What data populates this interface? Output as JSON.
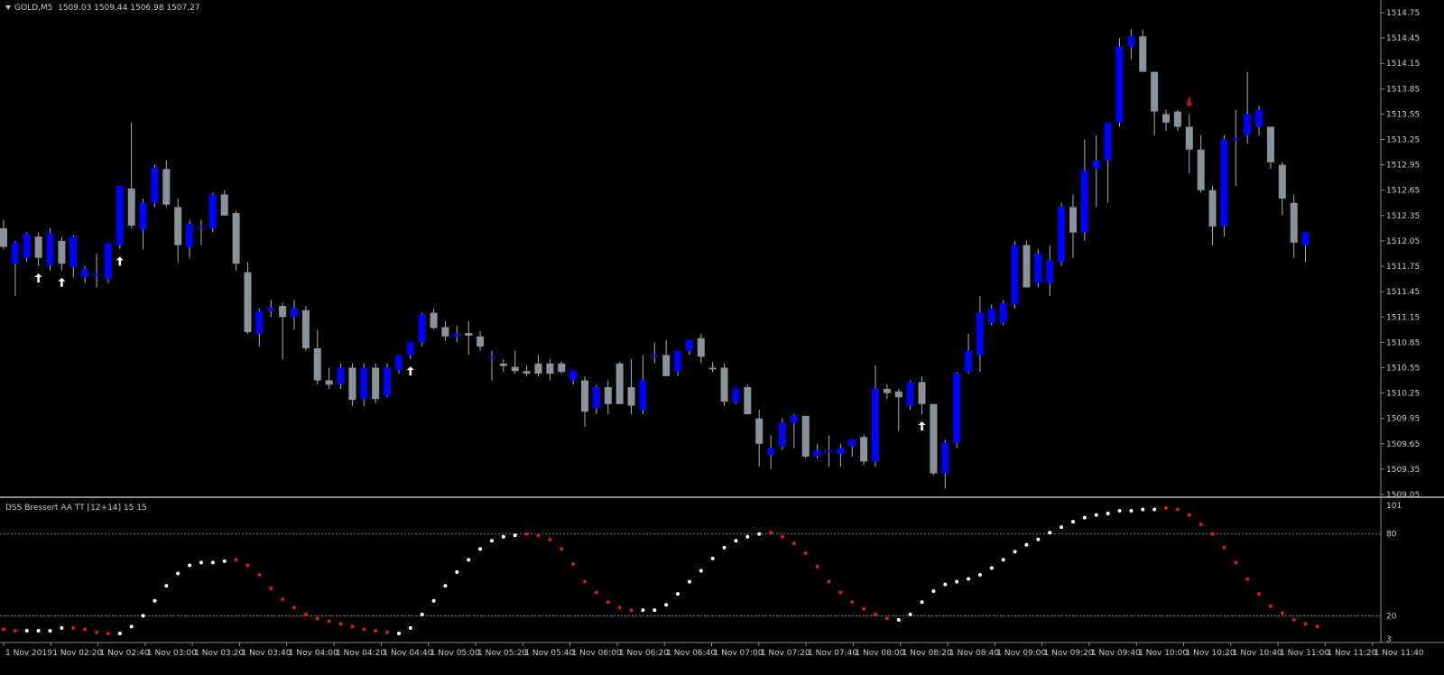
{
  "header": {
    "symbol": "GOLD,M5",
    "ohlc": "1509.03 1509.44 1506.98 1507.27"
  },
  "indicator": {
    "title": "DSS Bressert AA TT [12+14] 15 15"
  },
  "colors": {
    "background": "#000000",
    "bull_candle": "#0000ff",
    "bear_candle": "#8a939c",
    "wick": "#aab0b8",
    "axis": "#8a8a8a",
    "label": "#c8c8c8",
    "up_arrow": "#ffffff",
    "down_arrow": "#e01010",
    "dot_up": "#ffffff",
    "dot_down": "#e01818",
    "level_line": "#6a7a90"
  },
  "icons": {
    "up_arrow": "up-arrow-icon",
    "down_arrow": "down-arrow-icon",
    "header_triangle": "dropdown-triangle-icon"
  },
  "chart_data": {
    "type": "candlestick",
    "price_axis": {
      "min": 1509.05,
      "max": 1514.75,
      "ticks": [
        "1514.75",
        "1514.45",
        "1514.15",
        "1513.85",
        "1513.55",
        "1513.25",
        "1512.95",
        "1512.65",
        "1512.35",
        "1512.05",
        "1511.75",
        "1511.45",
        "1511.15",
        "1510.85",
        "1510.55",
        "1510.25",
        "1509.95",
        "1509.65",
        "1509.35",
        "1509.05"
      ]
    },
    "time_axis": {
      "labels": [
        "1 Nov 2019",
        "1 Nov 02:20",
        "1 Nov 02:40",
        "1 Nov 03:00",
        "1 Nov 03:20",
        "1 Nov 03:40",
        "1 Nov 04:00",
        "1 Nov 04:20",
        "1 Nov 04:40",
        "1 Nov 05:00",
        "1 Nov 05:20",
        "1 Nov 05:40",
        "1 Nov 06:00",
        "1 Nov 06:20",
        "1 Nov 06:40",
        "1 Nov 07:00",
        "1 Nov 07:20",
        "1 Nov 07:40",
        "1 Nov 08:00",
        "1 Nov 08:20",
        "1 Nov 08:40",
        "1 Nov 09:00",
        "1 Nov 09:20",
        "1 Nov 09:40",
        "1 Nov 10:00",
        "1 Nov 10:20",
        "1 Nov 10:40",
        "1 Nov 11:00",
        "1 Nov 11:20",
        "1 Nov 11:40"
      ]
    },
    "candles": [
      [
        1512.2,
        1512.3,
        1511.95,
        1511.98
      ],
      [
        1511.78,
        1512.05,
        1511.4,
        1512.03
      ],
      [
        1511.85,
        1512.15,
        1511.8,
        1512.13
      ],
      [
        1512.1,
        1512.15,
        1511.75,
        1511.85
      ],
      [
        1511.76,
        1512.2,
        1511.7,
        1512.14
      ],
      [
        1512.05,
        1512.1,
        1511.7,
        1511.78
      ],
      [
        1511.74,
        1512.12,
        1511.62,
        1512.1
      ],
      [
        1511.62,
        1511.75,
        1511.55,
        1511.72
      ],
      [
        1511.64,
        1511.9,
        1511.5,
        1511.66
      ],
      [
        1511.6,
        1512.0,
        1511.55,
        1512.02
      ],
      [
        1512.0,
        1512.7,
        1511.95,
        1512.7
      ],
      [
        1512.67,
        1513.45,
        1512.2,
        1512.23
      ],
      [
        1512.18,
        1512.55,
        1511.95,
        1512.5
      ],
      [
        1512.5,
        1512.95,
        1512.45,
        1512.92
      ],
      [
        1512.9,
        1513.0,
        1512.45,
        1512.48
      ],
      [
        1512.45,
        1512.55,
        1511.8,
        1512.0
      ],
      [
        1511.98,
        1512.3,
        1511.85,
        1512.25
      ],
      [
        1512.22,
        1512.3,
        1512.0,
        1512.22
      ],
      [
        1512.2,
        1512.62,
        1512.15,
        1512.6
      ],
      [
        1512.6,
        1512.65,
        1512.35,
        1512.35
      ],
      [
        1512.38,
        1512.4,
        1511.7,
        1511.78
      ],
      [
        1511.68,
        1511.8,
        1510.95,
        1510.97
      ],
      [
        1510.95,
        1511.25,
        1510.8,
        1511.22
      ],
      [
        1511.22,
        1511.35,
        1511.15,
        1511.26
      ],
      [
        1511.28,
        1511.32,
        1510.65,
        1511.15
      ],
      [
        1511.15,
        1511.35,
        1511.0,
        1511.25
      ],
      [
        1511.23,
        1511.28,
        1510.75,
        1510.78
      ],
      [
        1510.78,
        1511.0,
        1510.35,
        1510.4
      ],
      [
        1510.4,
        1510.55,
        1510.3,
        1510.35
      ],
      [
        1510.36,
        1510.6,
        1510.3,
        1510.55
      ],
      [
        1510.55,
        1510.6,
        1510.1,
        1510.17
      ],
      [
        1510.18,
        1510.6,
        1510.1,
        1510.55
      ],
      [
        1510.55,
        1510.6,
        1510.13,
        1510.18
      ],
      [
        1510.22,
        1510.6,
        1510.2,
        1510.55
      ],
      [
        1510.52,
        1510.7,
        1510.48,
        1510.7
      ],
      [
        1510.7,
        1510.85,
        1510.65,
        1510.85
      ],
      [
        1510.85,
        1511.2,
        1510.8,
        1511.18
      ],
      [
        1511.2,
        1511.25,
        1511.0,
        1511.02
      ],
      [
        1511.03,
        1511.1,
        1510.87,
        1510.92
      ],
      [
        1510.92,
        1511.05,
        1510.85,
        1510.95
      ],
      [
        1510.96,
        1511.1,
        1510.7,
        1510.93
      ],
      [
        1510.92,
        1510.98,
        1510.75,
        1510.8
      ],
      [
        1510.68,
        1510.75,
        1510.4,
        1510.68
      ],
      [
        1510.6,
        1510.65,
        1510.5,
        1510.57
      ],
      [
        1510.56,
        1510.75,
        1510.48,
        1510.51
      ],
      [
        1510.51,
        1510.58,
        1510.45,
        1510.48
      ],
      [
        1510.6,
        1510.7,
        1510.45,
        1510.48
      ],
      [
        1510.6,
        1510.65,
        1510.4,
        1510.48
      ],
      [
        1510.6,
        1510.62,
        1510.48,
        1510.5
      ],
      [
        1510.4,
        1510.52,
        1510.35,
        1510.52
      ],
      [
        1510.4,
        1510.45,
        1509.85,
        1510.03
      ],
      [
        1510.07,
        1510.35,
        1510.0,
        1510.32
      ],
      [
        1510.32,
        1510.4,
        1510.0,
        1510.12
      ],
      [
        1510.6,
        1510.62,
        1510.12,
        1510.12
      ],
      [
        1510.32,
        1510.65,
        1510.0,
        1510.1
      ],
      [
        1510.05,
        1510.7,
        1510.0,
        1510.4
      ],
      [
        1510.68,
        1510.85,
        1510.6,
        1510.7
      ],
      [
        1510.7,
        1510.88,
        1510.5,
        1510.45
      ],
      [
        1510.5,
        1510.72,
        1510.45,
        1510.75
      ],
      [
        1510.75,
        1510.88,
        1510.7,
        1510.88
      ],
      [
        1510.9,
        1510.95,
        1510.6,
        1510.68
      ],
      [
        1510.55,
        1510.62,
        1510.5,
        1510.53
      ],
      [
        1510.55,
        1510.6,
        1510.1,
        1510.15
      ],
      [
        1510.14,
        1510.3,
        1510.12,
        1510.3
      ],
      [
        1510.32,
        1510.35,
        1510.0,
        1510.0
      ],
      [
        1509.95,
        1510.05,
        1509.38,
        1509.65
      ],
      [
        1509.52,
        1509.75,
        1509.35,
        1509.6
      ],
      [
        1509.62,
        1509.95,
        1509.58,
        1509.9
      ],
      [
        1509.9,
        1510.0,
        1509.6,
        1509.98
      ],
      [
        1509.98,
        1509.98,
        1509.48,
        1509.5
      ],
      [
        1509.5,
        1509.65,
        1509.48,
        1509.57
      ],
      [
        1509.55,
        1509.75,
        1509.38,
        1509.57
      ],
      [
        1509.53,
        1509.65,
        1509.38,
        1509.6
      ],
      [
        1509.62,
        1509.7,
        1509.5,
        1509.7
      ],
      [
        1509.73,
        1509.76,
        1509.4,
        1509.44
      ],
      [
        1509.44,
        1510.58,
        1509.38,
        1510.3
      ],
      [
        1510.3,
        1510.35,
        1510.18,
        1510.25
      ],
      [
        1510.27,
        1510.3,
        1509.8,
        1510.2
      ],
      [
        1510.1,
        1510.4,
        1510.05,
        1510.38
      ],
      [
        1510.38,
        1510.45,
        1510.0,
        1510.12
      ],
      [
        1510.12,
        1510.12,
        1509.28,
        1509.3
      ],
      [
        1509.3,
        1509.7,
        1509.12,
        1509.66
      ],
      [
        1509.66,
        1510.5,
        1509.6,
        1510.48
      ],
      [
        1510.5,
        1510.95,
        1510.48,
        1510.75
      ],
      [
        1510.7,
        1511.4,
        1510.5,
        1511.2
      ],
      [
        1511.08,
        1511.3,
        1511.05,
        1511.25
      ],
      [
        1511.08,
        1511.35,
        1511.05,
        1511.31
      ],
      [
        1511.3,
        1512.05,
        1511.25,
        1512.0
      ],
      [
        1512.0,
        1512.05,
        1511.5,
        1511.5
      ],
      [
        1511.55,
        1511.95,
        1511.5,
        1511.9
      ],
      [
        1511.55,
        1512.0,
        1511.4,
        1511.82
      ],
      [
        1511.8,
        1512.5,
        1511.75,
        1512.45
      ],
      [
        1512.45,
        1512.6,
        1511.85,
        1512.15
      ],
      [
        1512.15,
        1513.25,
        1512.05,
        1512.88
      ],
      [
        1512.9,
        1513.3,
        1512.45,
        1513.0
      ],
      [
        1513.0,
        1513.45,
        1512.5,
        1513.45
      ],
      [
        1513.45,
        1514.45,
        1513.4,
        1514.35
      ],
      [
        1514.35,
        1514.55,
        1514.2,
        1514.47
      ],
      [
        1514.47,
        1514.55,
        1514.05,
        1514.05
      ],
      [
        1514.05,
        1514.05,
        1513.3,
        1513.58
      ],
      [
        1513.55,
        1513.6,
        1513.35,
        1513.45
      ],
      [
        1513.58,
        1513.6,
        1513.35,
        1513.4
      ],
      [
        1513.4,
        1513.55,
        1512.85,
        1513.13
      ],
      [
        1513.13,
        1513.3,
        1512.62,
        1512.65
      ],
      [
        1512.65,
        1512.7,
        1512.0,
        1512.22
      ],
      [
        1512.22,
        1513.3,
        1512.1,
        1513.25
      ],
      [
        1513.25,
        1513.6,
        1512.7,
        1513.27
      ],
      [
        1513.3,
        1514.05,
        1513.2,
        1513.55
      ],
      [
        1513.4,
        1513.65,
        1513.3,
        1513.6
      ],
      [
        1513.4,
        1513.4,
        1512.9,
        1512.98
      ],
      [
        1512.95,
        1512.98,
        1512.35,
        1512.55
      ],
      [
        1512.5,
        1512.6,
        1511.85,
        1512.03
      ],
      [
        1512.0,
        1512.15,
        1511.8,
        1512.15
      ]
    ],
    "up_signals": [
      3,
      5,
      10,
      35,
      79
    ],
    "down_signals": [
      102
    ],
    "indicator": {
      "name": "DSS Bressert AA TT [12+14] 15 15",
      "axis": {
        "min": 3,
        "max": 101,
        "ticks": [
          "101",
          "80",
          "20",
          "3"
        ]
      },
      "levels": [
        80,
        20
      ],
      "values": [
        10,
        9,
        9,
        9,
        9,
        11,
        11,
        10,
        8,
        7,
        7,
        12,
        20,
        31,
        42,
        51,
        57,
        59,
        59,
        60,
        61,
        57,
        50,
        40,
        32,
        26,
        21,
        18,
        16,
        14,
        12,
        10,
        9,
        8,
        7,
        11,
        21,
        31,
        42,
        52,
        61,
        69,
        75,
        78,
        79,
        80,
        79,
        76,
        69,
        58,
        45,
        37,
        30,
        26,
        24,
        24,
        24,
        28,
        36,
        45,
        53,
        62,
        70,
        75,
        78,
        80,
        81,
        78,
        73,
        66,
        56,
        45,
        37,
        30,
        25,
        21,
        18,
        17,
        21,
        30,
        38,
        43,
        45,
        47,
        50,
        55,
        61,
        67,
        72,
        76,
        81,
        85,
        89,
        92,
        94,
        95,
        97,
        97,
        98,
        98,
        99,
        98,
        94,
        87,
        80,
        70,
        59,
        47,
        36,
        27,
        22,
        17,
        14,
        12
      ]
    }
  }
}
